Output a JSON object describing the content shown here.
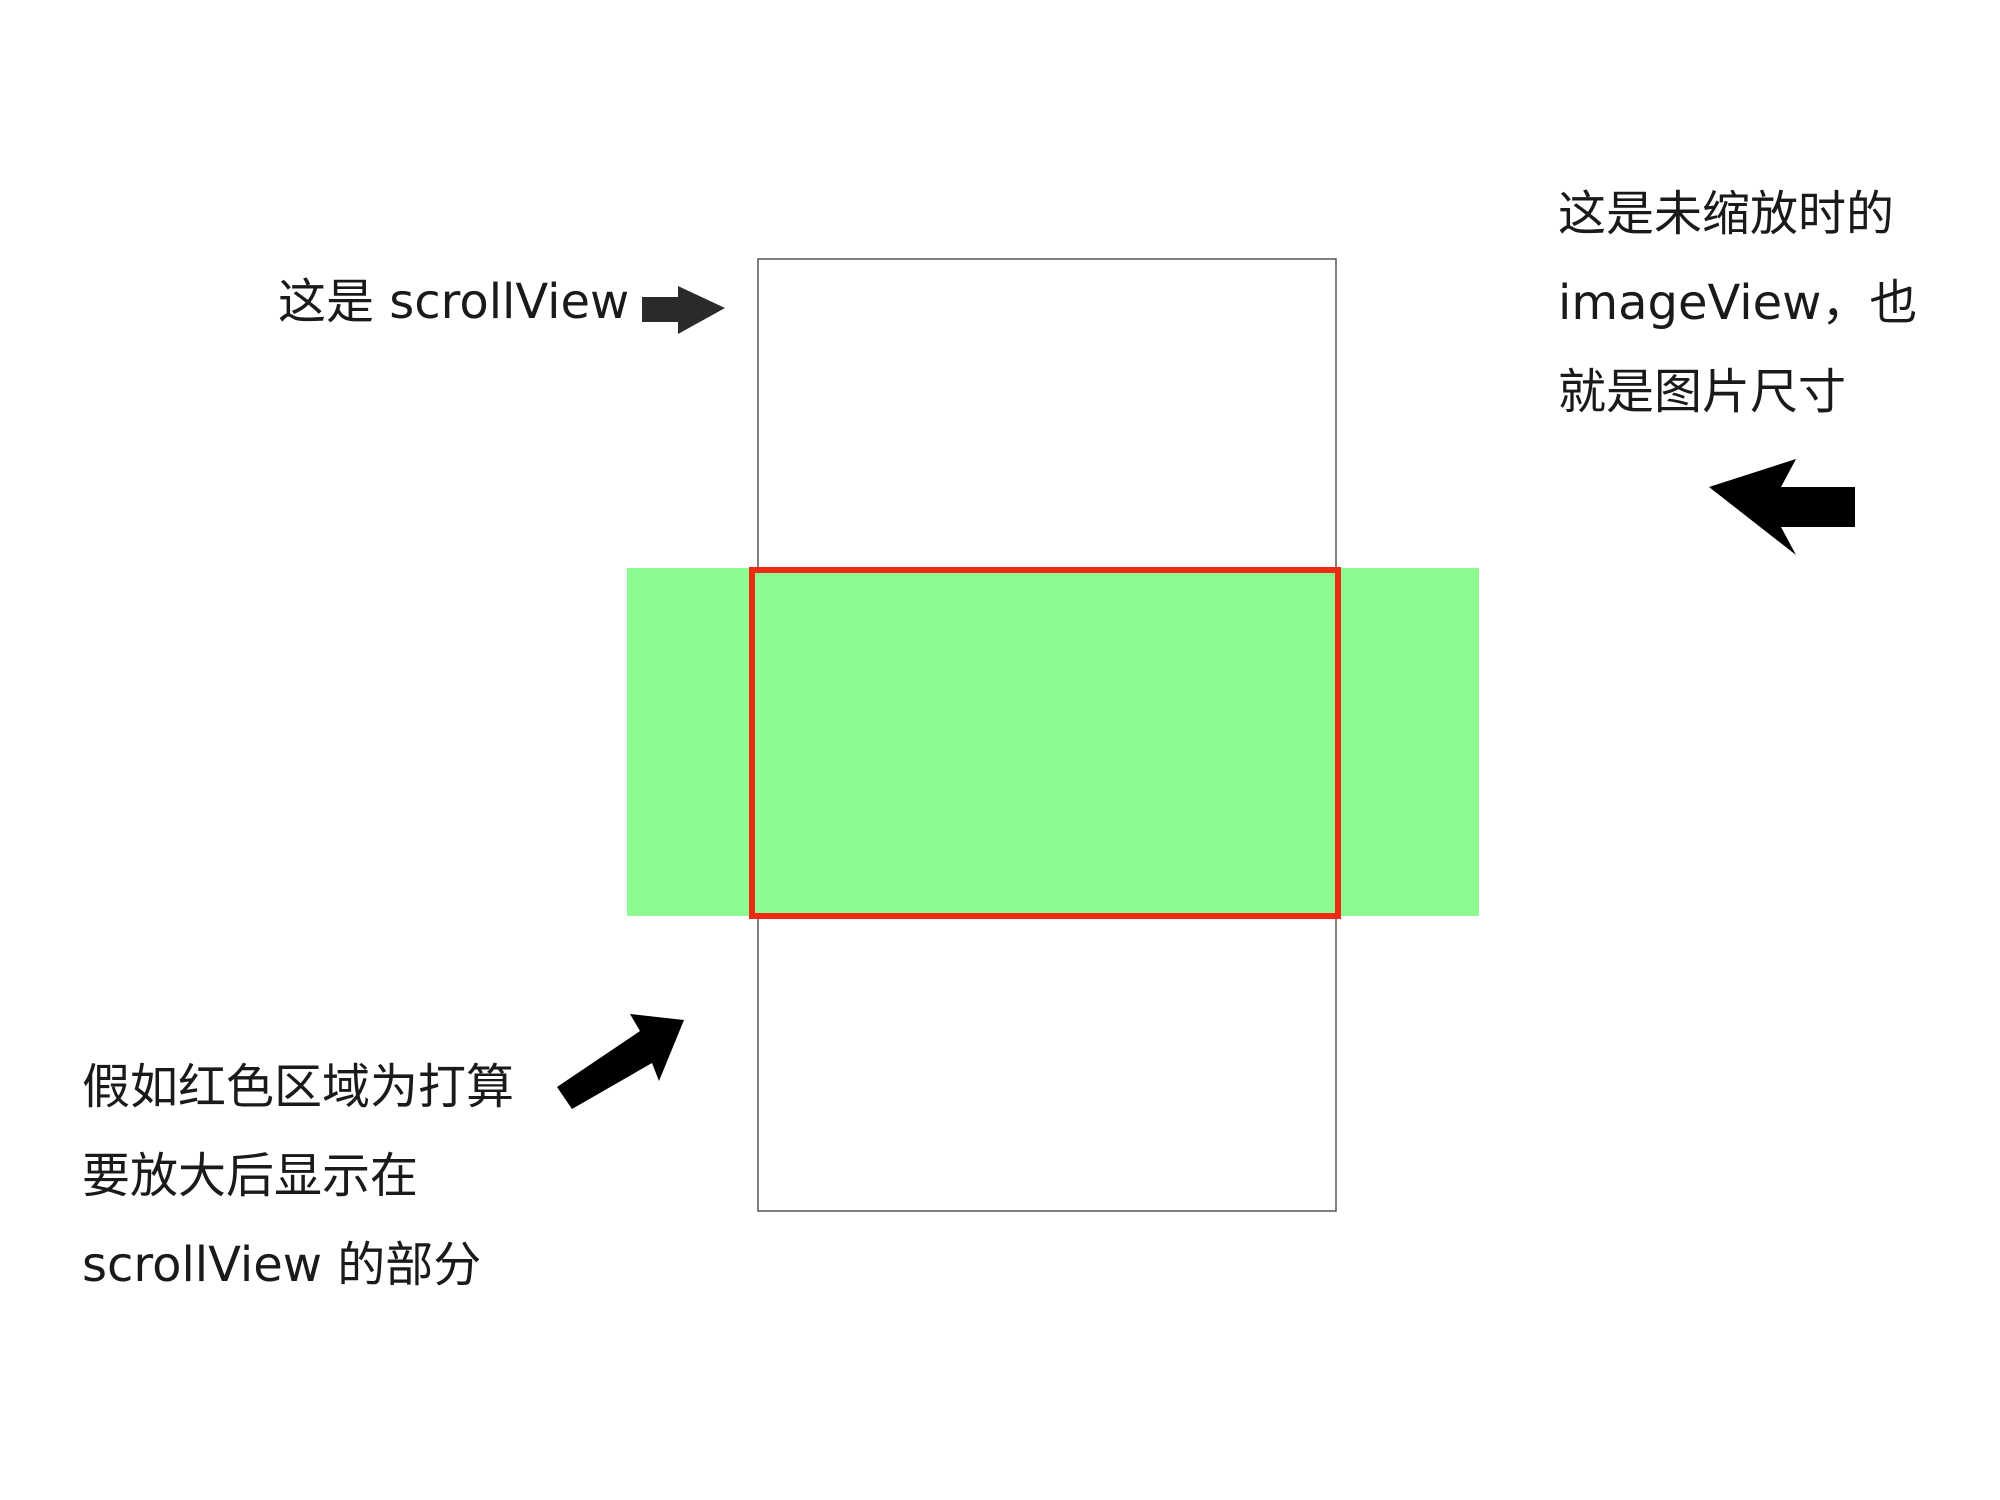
{
  "annotations": {
    "scrollview": {
      "text": "这是 scrollView"
    },
    "imageview": {
      "lines": [
        "这是未缩放时的",
        "imageView，也",
        "就是图片尺寸"
      ]
    },
    "red_region": {
      "lines": [
        "假如红色区域为打算",
        "要放大后显示在",
        "scrollView 的部分"
      ]
    }
  },
  "colors": {
    "background": "#ffffff",
    "scrollview_border": "#555555",
    "imageview_fill": "#8cfc91",
    "selection_border": "#ee2a14",
    "arrow_dark": "#2a2a2a",
    "arrow_black": "#000000",
    "text": "#1a1a1a"
  },
  "icons": {
    "scrollview_arrow": "arrow-right-icon",
    "imageview_arrow": "arrow-left-icon",
    "red_region_arrow": "arrow-up-right-icon"
  }
}
